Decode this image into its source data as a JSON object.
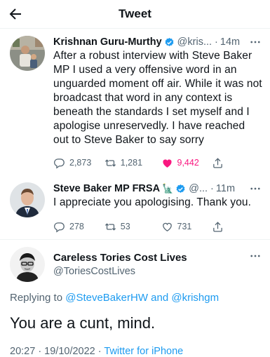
{
  "header": {
    "title": "Tweet",
    "back_icon": "arrow-left-icon"
  },
  "tweets": [
    {
      "name": "Krishnan Guru-Murthy",
      "handle": "@kris...",
      "dot": "·",
      "time": "14m",
      "verified": true,
      "text": "After a robust interview with Steve Baker MP I used a very offensive word in an unguarded moment off air.  While it was not broadcast that word in any context is beneath the standards I set myself and I apologise unreservedly. I have reached out to Steve Baker to say sorry",
      "replies": "2,873",
      "retweets": "1,281",
      "likes": "9,442",
      "liked": true
    },
    {
      "name": "Steve Baker MP FRSA",
      "handle": "@...",
      "dot": "·",
      "time": "11m",
      "verified": true,
      "emoji": "🗽",
      "text": "I appreciate you apologising. Thank you.",
      "replies": "278",
      "retweets": "53",
      "likes": "731",
      "liked": false
    }
  ],
  "focus": {
    "name": "Careless Tories Cost Lives",
    "handle": "@ToriesCostLives",
    "replying_label": "Replying to",
    "reply_handle_1": "@SteveBakerHW",
    "reply_and": "and",
    "reply_handle_2": "@krishgm",
    "text": "You are a cunt, mind.",
    "timestamp": "20:27 · 19/10/2022 ·",
    "source": "Twitter for iPhone"
  },
  "colors": {
    "accent": "#1d9bf0",
    "like": "#f91880",
    "muted": "#536471"
  }
}
